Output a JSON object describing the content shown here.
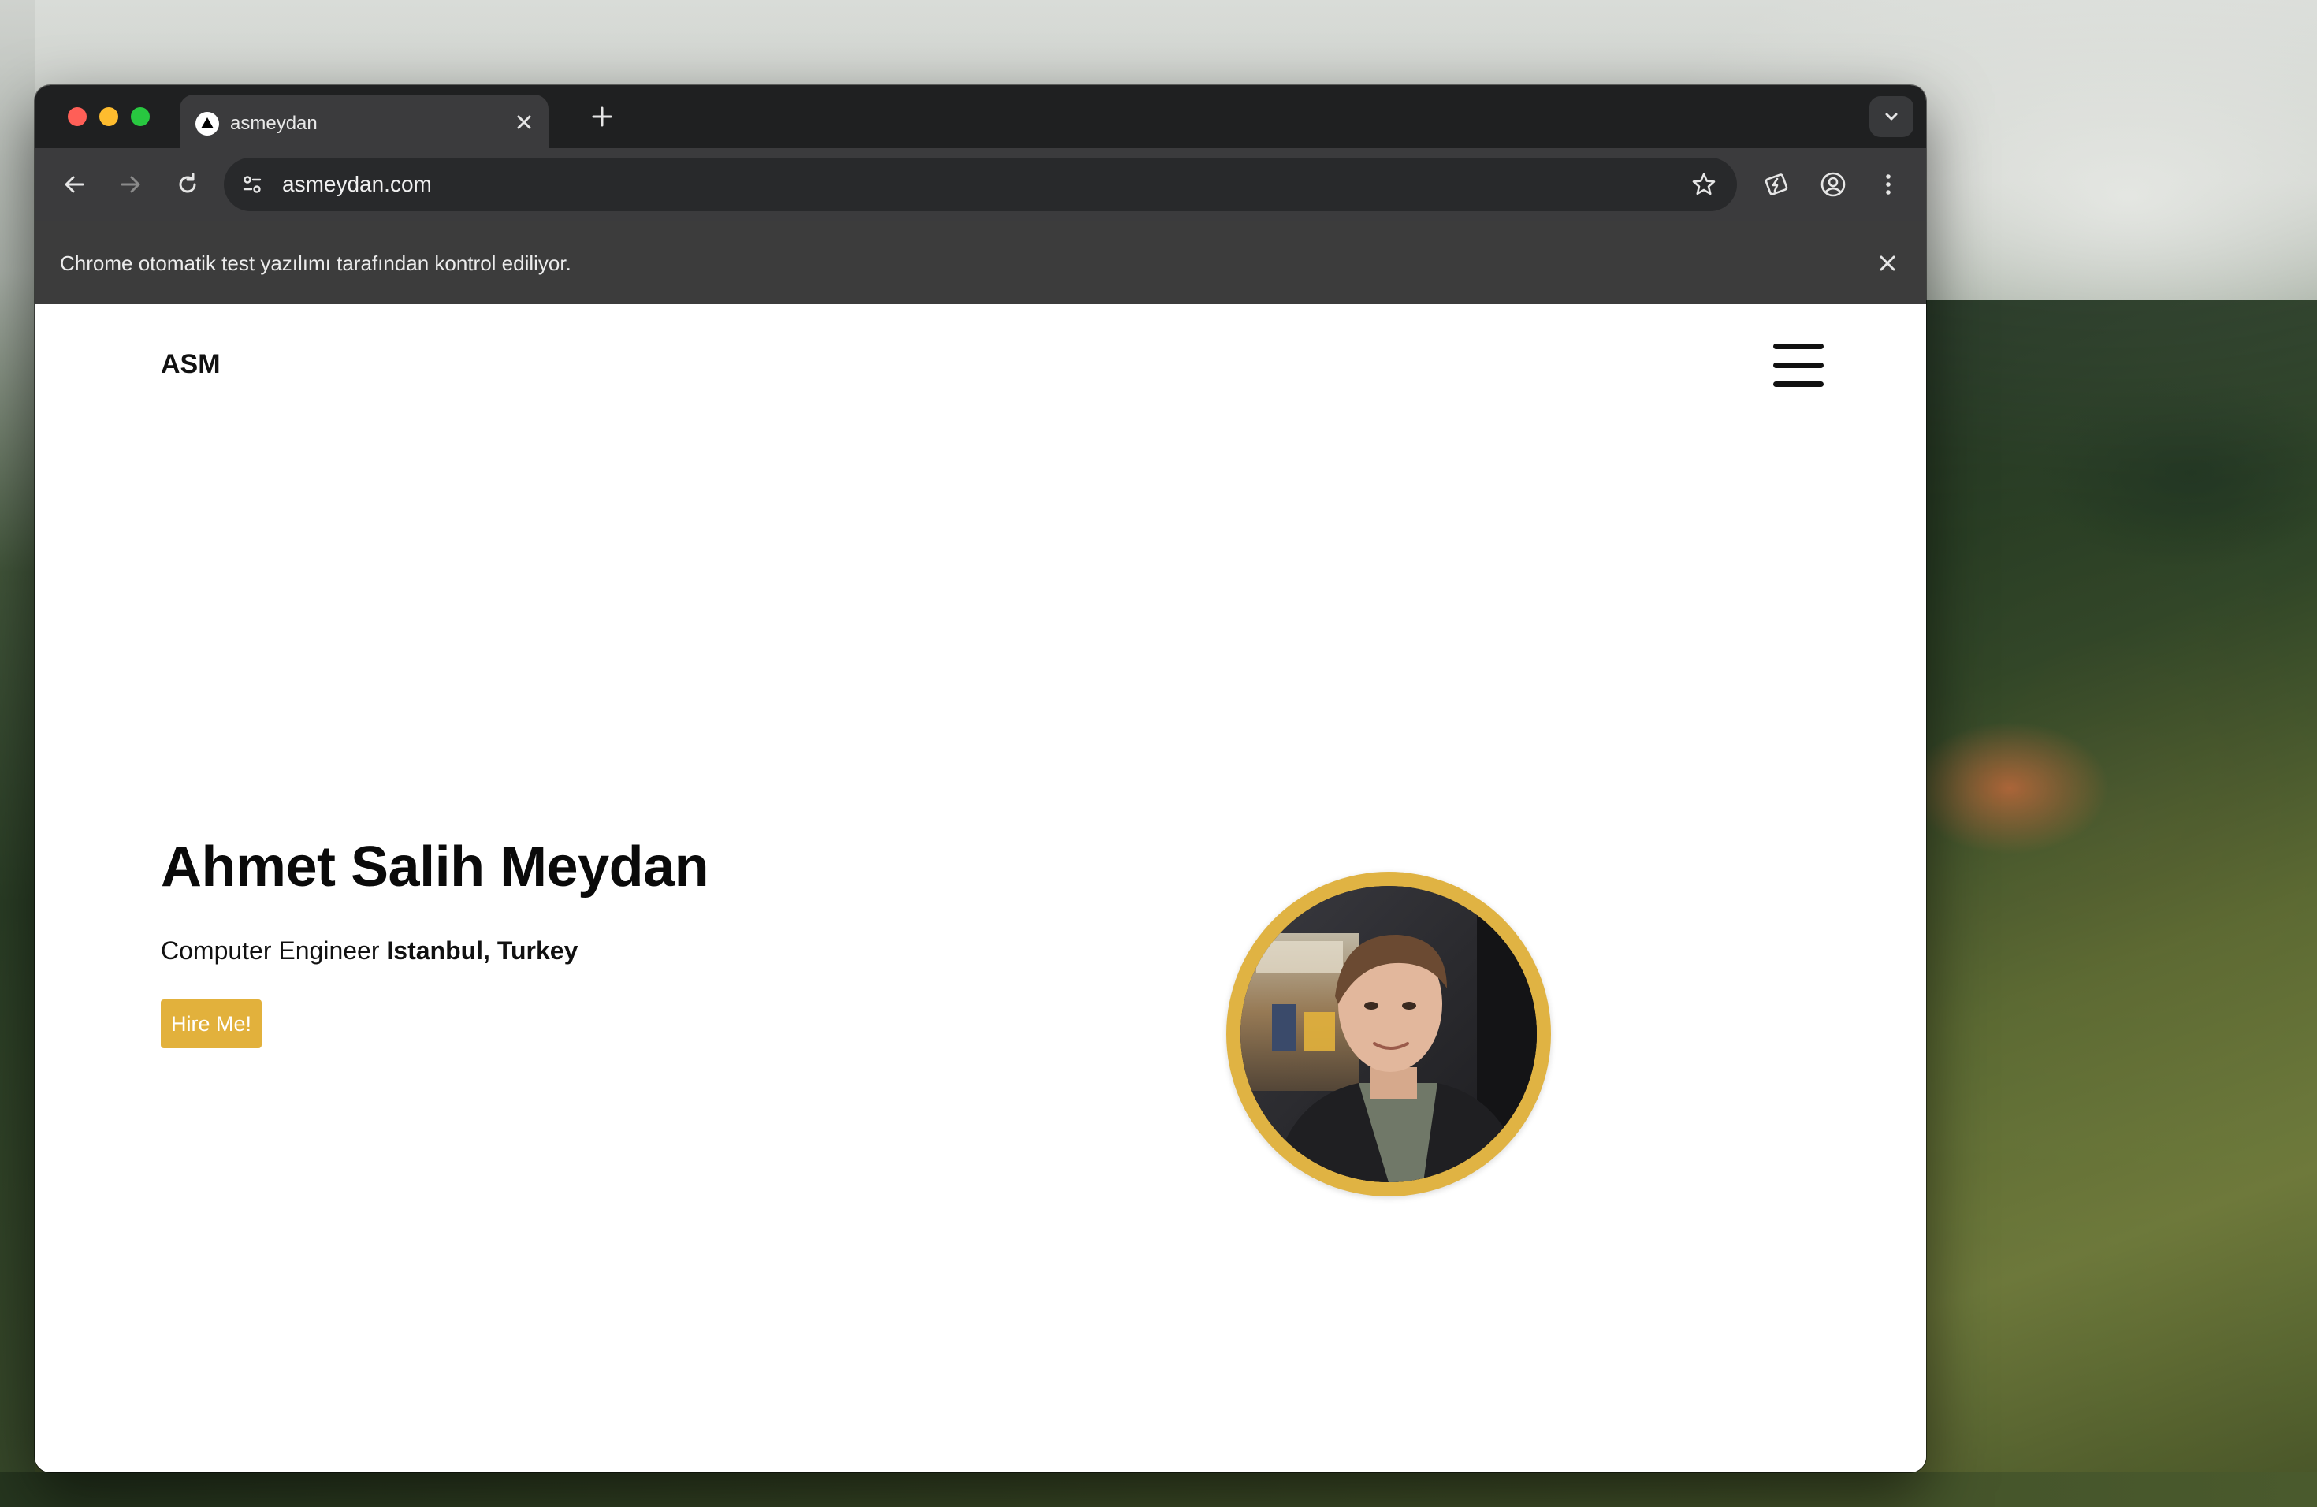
{
  "browser": {
    "tab_title": "asmeydan",
    "url": "asmeydan.com",
    "infobar_message": "Chrome otomatik test yazılımı tarafından kontrol ediliyor."
  },
  "site": {
    "logo": "ASM",
    "name": "Ahmet Salih Meydan",
    "role": "Computer Engineer",
    "location": "Istanbul, Turkey",
    "cta_label": "Hire Me!",
    "accent_color": "#e2b13c"
  },
  "icons": {
    "favicon": "triangle-logo-icon",
    "tab_close": "close-icon",
    "new_tab": "plus-icon",
    "tab_search": "chevron-down-icon",
    "back": "arrow-left-icon",
    "forward": "arrow-right-icon",
    "reload": "reload-icon",
    "site_info": "tune-icon",
    "bookmark": "star-icon",
    "extension": "extension-icon",
    "profile": "profile-icon",
    "menu": "more-vert-icon",
    "info_close": "close-icon",
    "nav_menu": "hamburger-menu-icon"
  }
}
